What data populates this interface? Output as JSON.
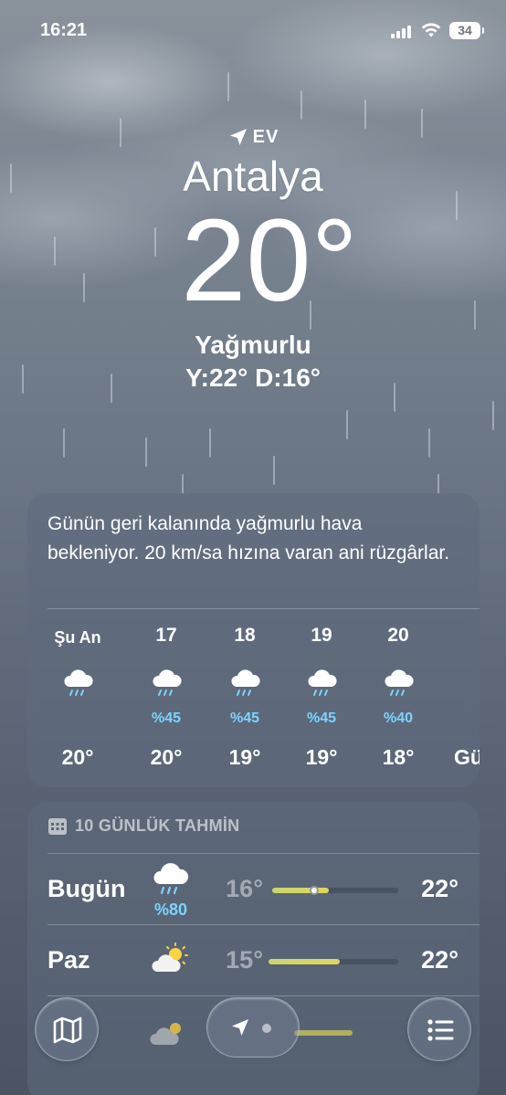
{
  "status_bar": {
    "time": "16:21",
    "battery": "34"
  },
  "header": {
    "location_label": "EV",
    "city": "Antalya",
    "temperature": "20°",
    "condition": "Yağmurlu",
    "high_low": "Y:22° D:16°"
  },
  "hourly": {
    "summary": "Günün geri kalanında yağmurlu hava bekleniyor. 20 km/sa hızına varan ani rüzgârlar.",
    "hours": [
      {
        "label": "Şu An",
        "icon": "cloud-rain-icon",
        "precip": "",
        "temp": "20°"
      },
      {
        "label": "17",
        "icon": "cloud-rain-icon",
        "precip": "%45",
        "temp": "20°"
      },
      {
        "label": "18",
        "icon": "cloud-rain-icon",
        "precip": "%45",
        "temp": "19°"
      },
      {
        "label": "19",
        "icon": "cloud-rain-icon",
        "precip": "%45",
        "temp": "19°"
      },
      {
        "label": "20",
        "icon": "cloud-rain-icon",
        "precip": "%40",
        "temp": "18°"
      },
      {
        "label": "",
        "icon": "",
        "precip": "",
        "temp": "Gü"
      }
    ]
  },
  "forecast": {
    "title": "10 GÜNLÜK TAHMİN",
    "days": [
      {
        "day": "Bugün",
        "icon": "cloud-rain-icon",
        "precip": "%80",
        "low": "16°",
        "high": "22°",
        "range_start": 0.0,
        "range_end": 0.45,
        "current_marker": 0.33
      },
      {
        "day": "Paz",
        "icon": "partly-cloudy-icon",
        "precip": "",
        "low": "15°",
        "high": "22°",
        "range_start": 0.0,
        "range_end": 0.55
      }
    ]
  },
  "toolbar": {
    "map": "map-icon",
    "location": "location-arrow-icon",
    "list": "list-icon"
  },
  "colors": {
    "precip_blue": "#7dd3ff",
    "temp_bar": "#d6d567"
  }
}
